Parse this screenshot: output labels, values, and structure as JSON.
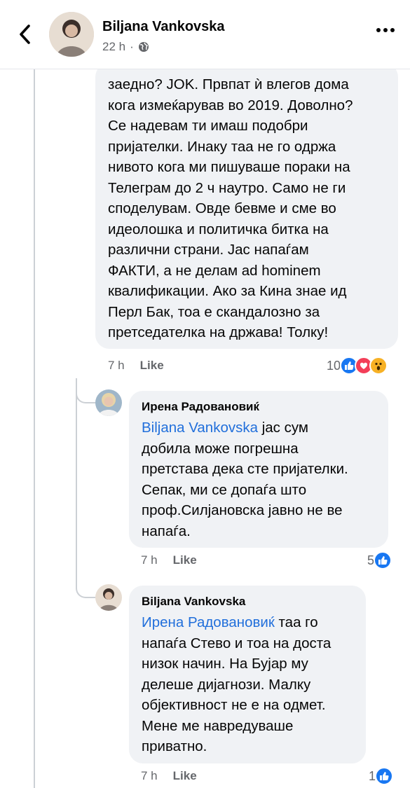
{
  "header": {
    "name": "Biljana Vankovska",
    "time": "22 h",
    "separator": "·"
  },
  "comments": [
    {
      "text": "заедно? JOK. Првпат ѝ влегов дома\nкога измеќарував во 2019. Доволно?\nСе надевам ти имаш подобри\nпријателки. Инаку таа не го одржа\nнивото кога ми пишуваше пораки на\nТелеграм до 2 ч наутро. Само не ги\nсподелувам. Овде бевме и сме во\nидеолошка и политичка битка на\nразлични страни. Јас напаѓам\nФАКТИ, а не делам ad hominem\nквалификации. Ако за Кина знае ид\nПерл Бак, тоа е скандалозно за\nпретседателка на држава! Толку!",
      "time": "7 h",
      "like": "Like",
      "reaction_count": "10",
      "reactions": [
        "like-reaction-icon",
        "love-reaction-icon",
        "wow-reaction-icon"
      ]
    },
    {
      "author": "Ирена Радовановиќ",
      "mention": "Biljana Vankovska",
      "text": " јас сум\nдобила може погрешна\nпретстава дека сте пријателки.\nСепак, ми се допаѓа што\nпроф.Силјановска јавно не ве\nнапаѓа.",
      "time": "7 h",
      "like": "Like",
      "reaction_count": "5",
      "reactions": [
        "like-reaction-icon"
      ]
    },
    {
      "author": "Biljana Vankovska",
      "mention": "Ирена Радовановиќ",
      "text": " таа го\nнапаѓа Стево и тоа на доста\nнизок начин. На Бујар му\nделеше дијагнози. Малку\nобјективност не е на одмет.\nМене ме навредуваше\nприватно.",
      "time": "7 h",
      "like": "Like",
      "reaction_count": "1",
      "reactions": [
        "like-reaction-icon"
      ]
    }
  ],
  "colors": {
    "bubble": "#f0f2f5",
    "mention": "#216fdb",
    "like_reaction": "#1877f2",
    "love_reaction": "#f33e58",
    "wow_reaction": "#f7b125",
    "meta": "#65676b"
  }
}
